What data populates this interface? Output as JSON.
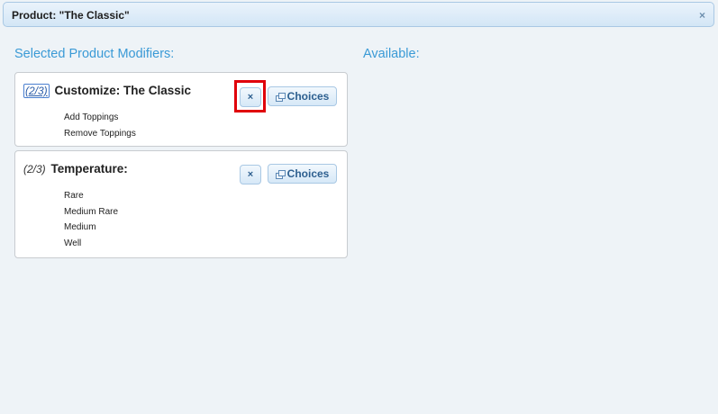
{
  "dialog": {
    "title": "Product: \"The Classic\"",
    "close_glyph": "×"
  },
  "headings": {
    "selected": "Selected Product Modifiers:",
    "available": "Available:"
  },
  "modifiers": [
    {
      "count": "(2/3)",
      "name": "Customize: The Classic",
      "remove_glyph": "×",
      "choices_label": "Choices",
      "options": [
        "Add Toppings",
        "Remove Toppings"
      ]
    },
    {
      "count": "(2/3)",
      "name": "Temperature:",
      "remove_glyph": "×",
      "choices_label": "Choices",
      "options": [
        "Rare",
        "Medium Rare",
        "Medium",
        "Well"
      ]
    }
  ],
  "colors": {
    "accent": "#3a9ad6",
    "highlight": "#e0000a"
  }
}
